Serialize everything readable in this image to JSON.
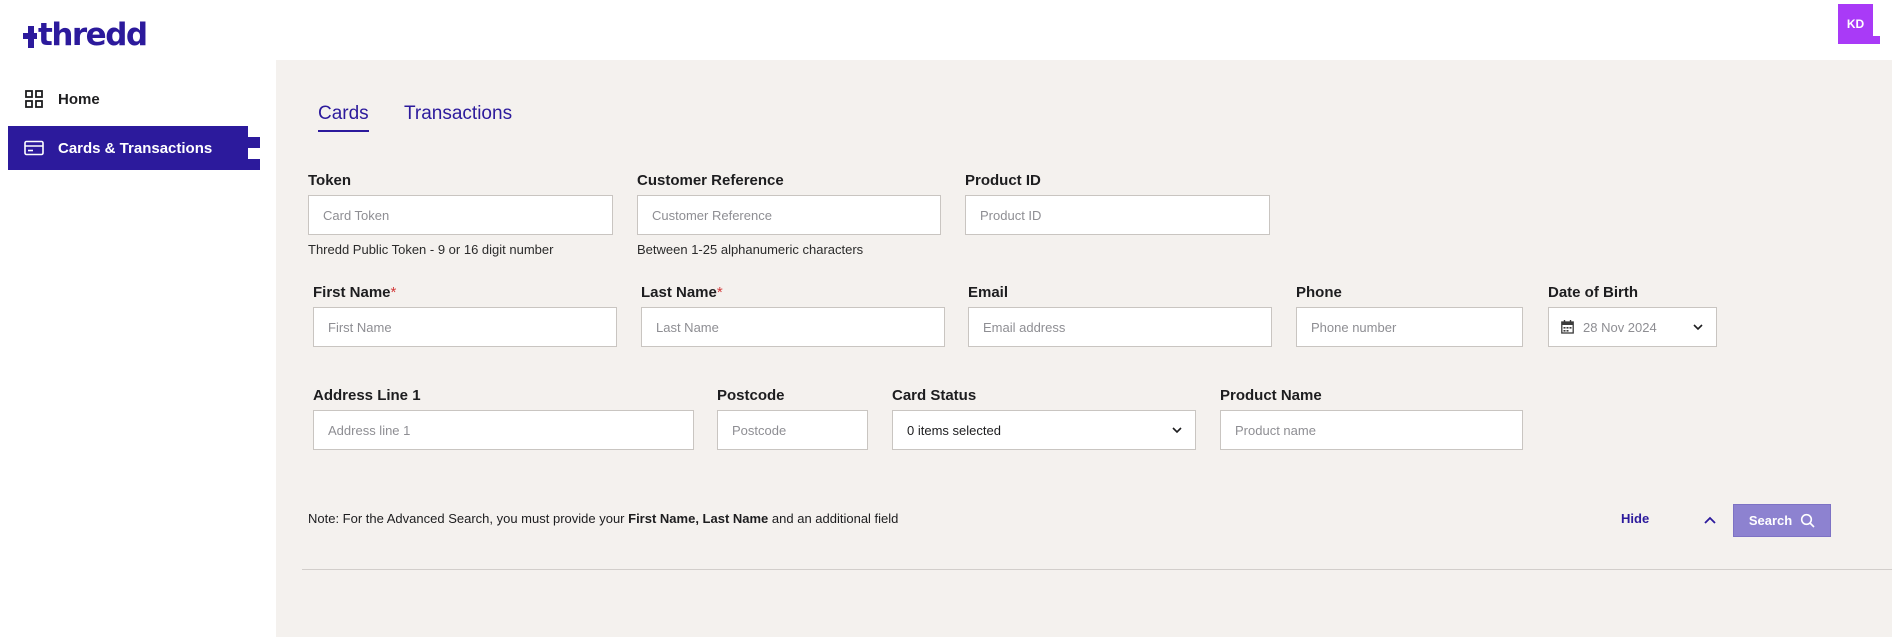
{
  "app": {
    "logo_text": "thredd",
    "avatar_initials": "KD"
  },
  "sidebar": {
    "items": [
      {
        "label": "Home",
        "icon": "grid-icon"
      },
      {
        "label": "Cards & Transactions",
        "icon": "card-icon",
        "active": true
      }
    ]
  },
  "tabs": [
    {
      "label": "Cards",
      "active": true
    },
    {
      "label": "Transactions",
      "active": false
    }
  ],
  "form": {
    "token": {
      "label": "Token",
      "placeholder": "Card Token",
      "hint": "Thredd Public Token - 9 or 16 digit number"
    },
    "customer_reference": {
      "label": "Customer Reference",
      "placeholder": "Customer Reference",
      "hint": "Between 1-25 alphanumeric characters"
    },
    "product_id": {
      "label": "Product ID",
      "placeholder": "Product ID"
    },
    "first_name": {
      "label": "First Name",
      "required_mark": "*",
      "placeholder": "First Name"
    },
    "last_name": {
      "label": "Last Name",
      "required_mark": "*",
      "placeholder": "Last Name"
    },
    "email": {
      "label": "Email",
      "placeholder": "Email address"
    },
    "phone": {
      "label": "Phone",
      "placeholder": "Phone number"
    },
    "dob": {
      "label": "Date of Birth",
      "placeholder": "28 Nov 2024"
    },
    "address_line_1": {
      "label": "Address Line 1",
      "placeholder": "Address line 1"
    },
    "postcode": {
      "label": "Postcode",
      "placeholder": "Postcode"
    },
    "card_status": {
      "label": "Card Status",
      "value": "0 items selected"
    },
    "product_name": {
      "label": "Product Name",
      "placeholder": "Product name"
    }
  },
  "note": {
    "prefix": "Note: For the Advanced Search, you must provide your ",
    "bold": "First Name, Last Name",
    "suffix": " and an additional field"
  },
  "actions": {
    "hide_label": "Hide",
    "search_label": "Search"
  },
  "colors": {
    "brand": "#2c1a9c",
    "avatar": "#a93af7",
    "panel_bg": "#f4f1ee",
    "search_btn": "#8d82d0",
    "required": "#d23b3b"
  }
}
